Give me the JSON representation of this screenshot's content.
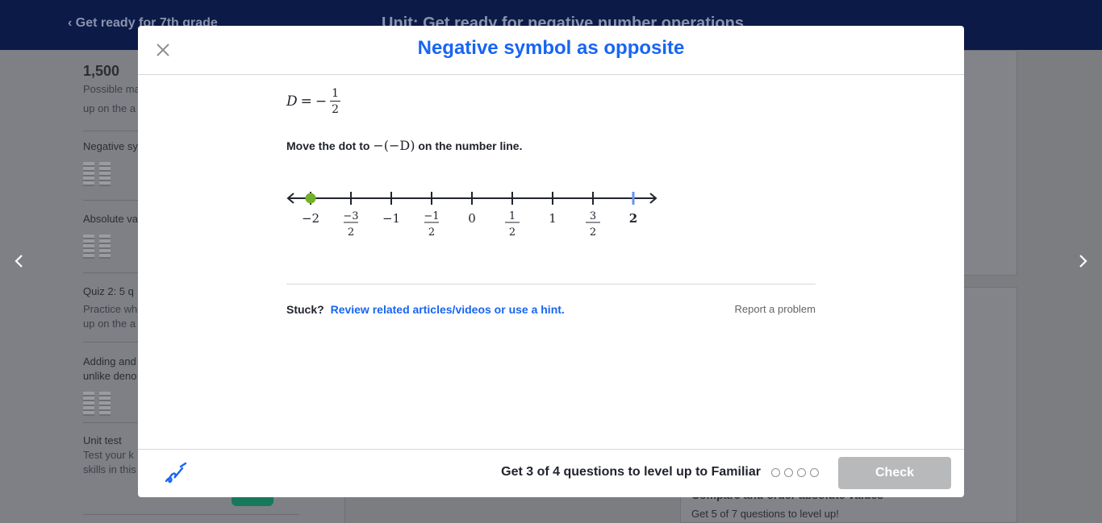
{
  "background": {
    "back_link": "Get ready for 7th grade",
    "unit_title": "Unit: Get ready for negative number operations",
    "points": "1,500",
    "points_desc": "Possible ma",
    "points_desc2": "up on the a",
    "items": [
      {
        "label": "Negative sy"
      },
      {
        "label": "Absolute va"
      },
      {
        "label": "Quiz 2: 5 q",
        "desc1": "Practice wh",
        "desc2": "up on the a"
      },
      {
        "label": "Adding and",
        "label2": "unlike deno"
      },
      {
        "label": "Unit test",
        "desc1": "Test your k",
        "desc2": "skills in this"
      }
    ],
    "right_card_title": "Compare and order absolute values",
    "right_card_desc": "Get 5 of 7 questions to level up!"
  },
  "modal": {
    "title": "Negative symbol as opposite",
    "equation": {
      "variable": "D",
      "equals": "=",
      "sign": "−",
      "numerator": "1",
      "denominator": "2"
    },
    "instruction_before": "Move the dot to",
    "instruction_math": "−(−D)",
    "instruction_after": "on the number line.",
    "number_line": {
      "ticks": [
        {
          "value": -2,
          "label": "−2"
        },
        {
          "value": -1.5,
          "num": "−3",
          "den": "2"
        },
        {
          "value": -1,
          "label": "−1"
        },
        {
          "value": -0.5,
          "num": "−1",
          "den": "2"
        },
        {
          "value": 0,
          "label": "0"
        },
        {
          "value": 0.5,
          "num": "1",
          "den": "2"
        },
        {
          "value": 1,
          "label": "1"
        },
        {
          "value": 1.5,
          "num": "3",
          "den": "2"
        },
        {
          "value": 2,
          "label": "2"
        }
      ],
      "dot_value": -2,
      "highlight_value": 2,
      "dot_color": "#72b22a",
      "highlight_color": "#6495ed"
    },
    "stuck_label": "Stuck?",
    "stuck_link": "Review related articles/videos or use a hint.",
    "report_label": "Report a problem",
    "progress_text": "Get 3 of 4 questions to level up to Familiar",
    "progress_dots": 4,
    "check_label": "Check"
  }
}
